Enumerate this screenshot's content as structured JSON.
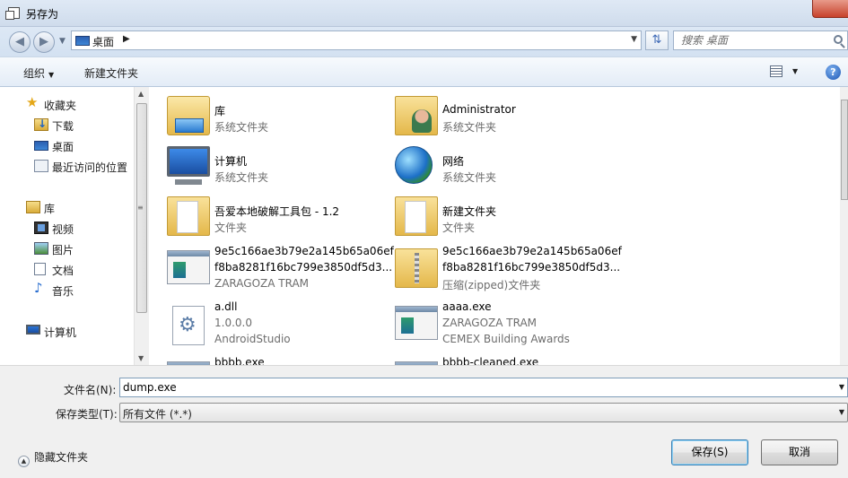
{
  "window": {
    "title": "另存为"
  },
  "address": {
    "crumb": "桌面",
    "search_placeholder": "搜索 桌面"
  },
  "toolbar": {
    "organize": "组织",
    "new_folder": "新建文件夹",
    "help": "?"
  },
  "nav": {
    "favorites": "收藏夹",
    "downloads": "下载",
    "desktop": "桌面",
    "recent": "最近访问的位置",
    "libraries": "库",
    "videos": "视频",
    "pictures": "图片",
    "documents": "文档",
    "music": "音乐",
    "computer": "计算机"
  },
  "files": [
    {
      "name": "库",
      "sub": "系统文件夹",
      "icon": "library-icon"
    },
    {
      "name": "Administrator",
      "sub": "系统文件夹",
      "icon": "user-folder-icon"
    },
    {
      "name": "计算机",
      "sub": "系统文件夹",
      "icon": "computer-icon"
    },
    {
      "name": "网络",
      "sub": "系统文件夹",
      "icon": "network-icon"
    },
    {
      "name": "吾爱本地破解工具包 - 1.2",
      "sub": "文件夹",
      "icon": "folder-icon"
    },
    {
      "name": "新建文件夹",
      "sub": "文件夹",
      "icon": "folder-icon"
    },
    {
      "line1": "9e5c166ae3b79e2a145b65a06ef",
      "line2": "f8ba8281f16bc799e3850df5d3...",
      "line3": "ZARAGOZA TRAM",
      "icon": "app-icon"
    },
    {
      "line1": "9e5c166ae3b79e2a145b65a06ef",
      "line2": "f8ba8281f16bc799e3850df5d3...",
      "line3": "压缩(zipped)文件夹",
      "icon": "zip-folder-icon"
    },
    {
      "line1": "a.dll",
      "line2": "1.0.0.0",
      "line3": "AndroidStudio",
      "icon": "dll-icon"
    },
    {
      "line1": "aaaa.exe",
      "line2": "ZARAGOZA TRAM",
      "line3": "CEMEX Building Awards",
      "icon": "app-icon"
    },
    {
      "name": "bbbb.exe",
      "icon": "app-icon"
    },
    {
      "name": "bbbb-cleaned.exe",
      "icon": "app-icon"
    }
  ],
  "form": {
    "filename_label": "文件名(N):",
    "filename_value": "dump.exe",
    "filetype_label": "保存类型(T):",
    "filetype_value": "所有文件 (*.*)",
    "hide_folders": "隐藏文件夹",
    "save": "保存(S)",
    "cancel": "取消"
  }
}
